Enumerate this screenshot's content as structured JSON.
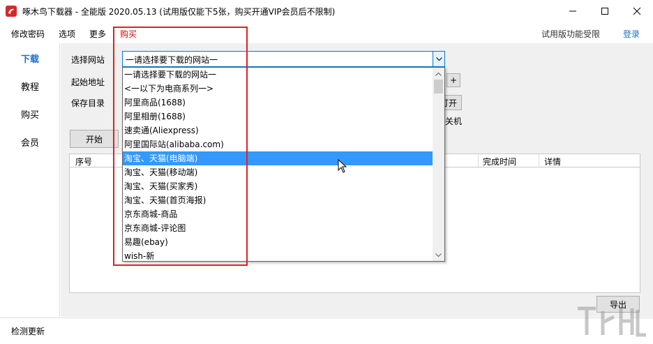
{
  "window": {
    "title": "啄木鸟下载器 - 全能版 2020.05.13 (试用版仅能下5张，购买开通VIP会员后不限制)"
  },
  "menu": {
    "items": [
      "修改密码",
      "选项",
      "更多",
      "购买"
    ],
    "trial_note": "试用版功能受限",
    "login": "登录"
  },
  "nav": {
    "items": [
      "下载",
      "教程",
      "购买",
      "会员"
    ],
    "active": "下载"
  },
  "form": {
    "site_label": "选择网站",
    "start_url_label": "起始地址",
    "save_dir_label": "保存目录",
    "plus_label": "+",
    "open_label": "打开",
    "shutdown_label": "关机",
    "start_button": "开始"
  },
  "combo": {
    "value": "一请选择要下载的网站一"
  },
  "dropdown": {
    "options": [
      "一请选择要下载的网站一",
      "<一以下为电商系列一>",
      "阿里商品(1688)",
      "阿里相册(1688)",
      "速卖通(Aliexpress)",
      "阿里国际站(alibaba.com)",
      "淘宝、天猫(电脑端)",
      "淘宝、天猫(移动端)",
      "淘宝、天猫(买家秀)",
      "淘宝、天猫(首页海报)",
      "京东商城-商品",
      "京东商城-评论图",
      "易趣(ebay)",
      "wish-新"
    ],
    "selected_index": 6
  },
  "table": {
    "headers": [
      "序号",
      "完成时间",
      "详情"
    ]
  },
  "export_button": "导出",
  "status": {
    "text": "检测更新"
  },
  "colors": {
    "accent": "#1f6fd1",
    "buy": "#e00000",
    "highlight": "#e02020",
    "selection": "#3399ff"
  }
}
